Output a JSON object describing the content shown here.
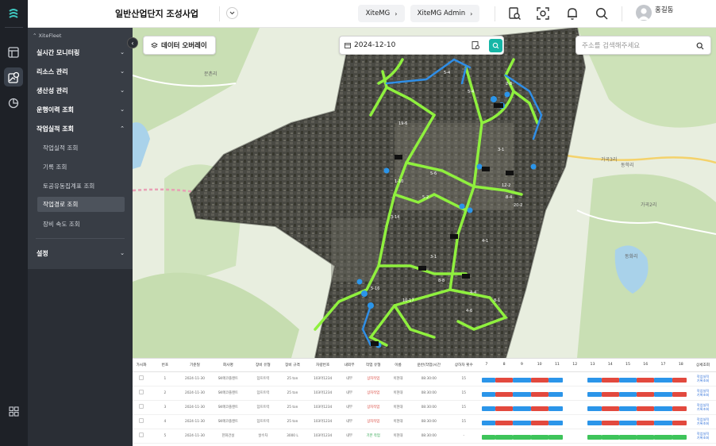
{
  "project": {
    "title": "일반산업단지 조성사업"
  },
  "header": {
    "xitemg_label": "XiteMG",
    "admin_label": "XiteMG Admin",
    "user_name": "홍길동"
  },
  "sidebar": {
    "crumb": "XiteFleet",
    "menu": [
      {
        "label": "실시간 모니터링"
      },
      {
        "label": "리소스 관리"
      },
      {
        "label": "생산성 관리"
      },
      {
        "label": "운행이력 조회"
      },
      {
        "label": "작업실적 조회"
      }
    ],
    "submenu": [
      {
        "label": "작업실적 조회"
      },
      {
        "label": "기록 조회"
      },
      {
        "label": "토공유동집계표 조회"
      },
      {
        "label": "작업경로 조회"
      },
      {
        "label": "장비 속도 조회"
      }
    ],
    "settings": "설정"
  },
  "map": {
    "overlay_button": "데이터 오버레이",
    "date": "2024-12-10",
    "search_placeholder": "주소를 검색해주세요",
    "labels": [
      "문촌리",
      "가곡3리",
      "동학리",
      "가곡2리",
      "동화리"
    ],
    "route_labels": [
      "5-4",
      "2-8",
      "19-6",
      "1-10",
      "5-2",
      "8-4",
      "3-14",
      "3-1",
      "4-4",
      "5-16",
      "8-1",
      "10-17",
      "12-2",
      "5-6",
      "3-1",
      "20-2",
      "4-1",
      "5-4",
      "8-8",
      "4-6"
    ]
  },
  "table": {
    "headers": [
      "가시화",
      "번호",
      "기준일",
      "회사명",
      "장비 유형",
      "장비 규격",
      "차량번호",
      "내외부",
      "작업 유형",
      "이름",
      "운반(작업)시간",
      "상하차 횟수",
      "7",
      "8",
      "9",
      "10",
      "11",
      "12",
      "13",
      "14",
      "15",
      "16",
      "17",
      "18",
      "상세조회"
    ],
    "rows": [
      {
        "no": "1",
        "date": "2024-11-30",
        "company": "SK에코플랜트",
        "type": "덤프트럭",
        "spec": "25 ton",
        "plate": "103아1234",
        "inout": "내부",
        "work": "상차작업",
        "name": "이현대",
        "time": "08:30:00",
        "count": "15",
        "style": "split"
      },
      {
        "no": "2",
        "date": "2024-11-30",
        "company": "SK에코플랜트",
        "type": "덤프트럭",
        "spec": "25 ton",
        "plate": "103아1234",
        "inout": "내부",
        "work": "상차작업",
        "name": "이현대",
        "time": "08:30:00",
        "count": "15",
        "style": "split"
      },
      {
        "no": "3",
        "date": "2024-11-30",
        "company": "SK에코플랜트",
        "type": "덤프트럭",
        "spec": "25 ton",
        "plate": "103아1234",
        "inout": "내부",
        "work": "상차작업",
        "name": "이현대",
        "time": "08:30:00",
        "count": "15",
        "style": "split"
      },
      {
        "no": "4",
        "date": "2024-11-30",
        "company": "SK에코플랜트",
        "type": "덤프트럭",
        "spec": "25 ton",
        "plate": "103아1234",
        "inout": "내부",
        "work": "상차작업",
        "name": "이현대",
        "time": "08:30:00",
        "count": "15",
        "style": "split"
      },
      {
        "no": "5",
        "date": "2024-11-30",
        "company": "한화건설",
        "type": "살수차",
        "spec": "3000 L",
        "plate": "103아1234",
        "inout": "내부",
        "work": "기본 작업",
        "name": "이현대",
        "time": "08:30:00",
        "count": "-",
        "style": "green"
      }
    ],
    "detail_links": [
      "작업실적",
      "기록조회"
    ]
  },
  "colors": {
    "blue": "#2b95e9",
    "red": "#e2493e",
    "green": "#3ec45a",
    "route": "#8ff03e",
    "route_blue": "#2f8ee6"
  }
}
